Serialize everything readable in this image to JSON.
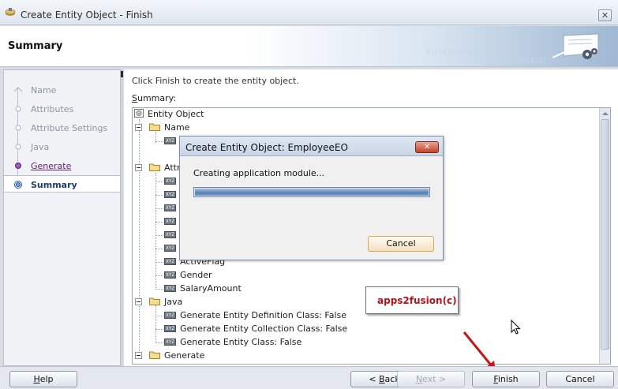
{
  "window": {
    "title": "Create Entity Object - Finish",
    "close_glyph": "✕"
  },
  "header": {
    "heading": "Summary",
    "binary_line1": "0101010101010101010101",
    "binary_line2": "0101010101"
  },
  "nav": {
    "steps": [
      {
        "label": "Name",
        "state": "inactive"
      },
      {
        "label": "Attributes",
        "state": "inactive"
      },
      {
        "label": "Attribute Settings",
        "state": "inactive"
      },
      {
        "label": "Java",
        "state": "inactive"
      },
      {
        "label": "Generate",
        "state": "visited"
      },
      {
        "label": "Summary",
        "state": "current"
      }
    ]
  },
  "main": {
    "instruction": "Click Finish to create the entity object.",
    "summary_label_first": "S",
    "summary_label_rest": "ummary:"
  },
  "tree": {
    "root": "Entity Object",
    "folder_name": "Name",
    "folder_attributes_partial": "Attr",
    "attr_activeflag": "ActiveFlag",
    "attr_gender": "Gender",
    "attr_salary": "SalaryAmount",
    "folder_java": "Java",
    "java_def": "Generate Entity Definition Class: False",
    "java_coll": "Generate Entity Collection Class: False",
    "java_ent": "Generate Entity Class: False",
    "folder_generate": "Generate",
    "attr_icon_text": "XYZ"
  },
  "modal": {
    "title": "Create Entity Object: EmployeeEO",
    "message": "Creating application module...",
    "progress": 1.0,
    "cancel_label": "Cancel",
    "close_glyph": "✕"
  },
  "watermark": {
    "text": "apps2fusion(c)"
  },
  "buttons": {
    "help_mn": "H",
    "help_rest": "elp",
    "back_pre": "< ",
    "back_mn": "B",
    "back_rest": "ack",
    "next_mn": "N",
    "next_rest": "ext >",
    "finish_mn": "F",
    "finish_rest": "inish",
    "cancel": "Cancel"
  },
  "colors": {
    "annotation_arrow": "#c0181c",
    "watermark_text": "#b4141a",
    "visited_link": "#5c1e78"
  }
}
